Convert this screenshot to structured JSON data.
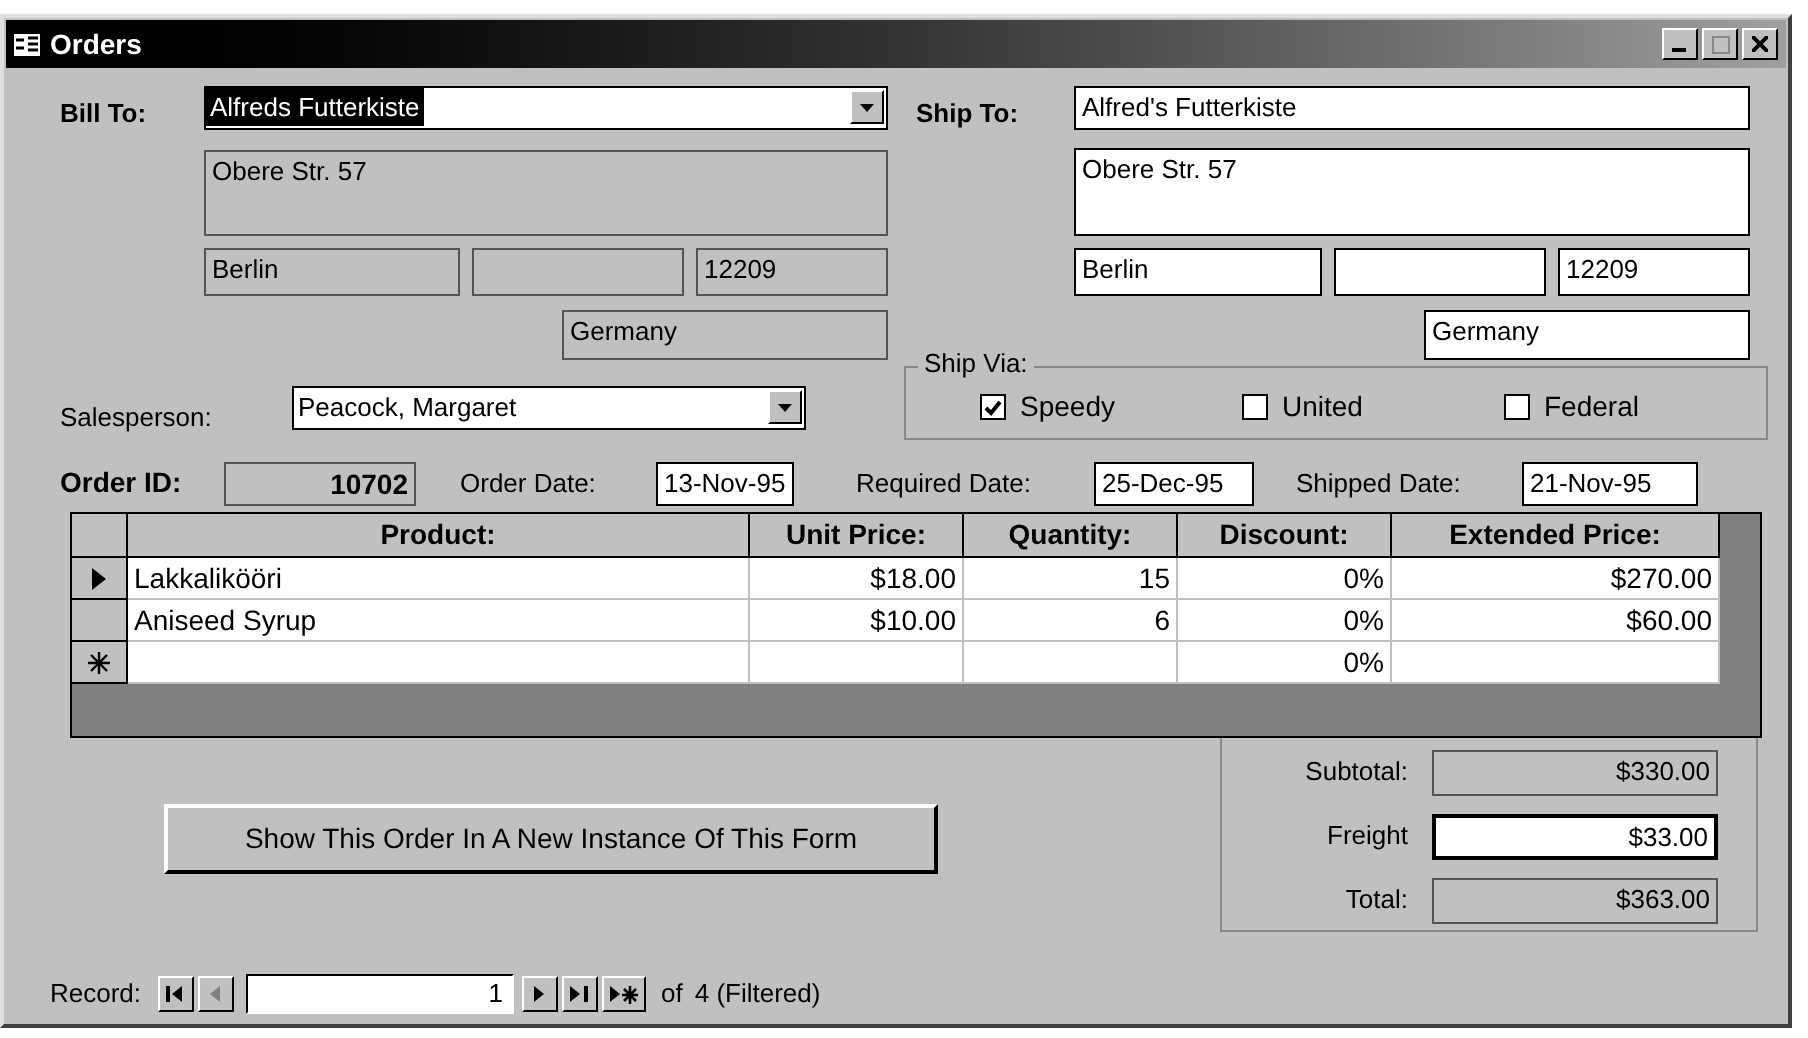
{
  "window": {
    "title": "Orders"
  },
  "bill_to": {
    "label": "Bill To:",
    "name": "Alfreds Futterkiste",
    "name_selected": true,
    "address": "Obere Str. 57",
    "city": "Berlin",
    "postal_code": "12209",
    "country": "Germany"
  },
  "ship_to": {
    "label": "Ship To:",
    "name": "Alfred's Futterkiste",
    "address": "Obere Str. 57",
    "city": "Berlin",
    "postal_code": "12209",
    "country": "Germany"
  },
  "salesperson": {
    "label": "Salesperson:",
    "value": "Peacock, Margaret"
  },
  "ship_via": {
    "label": "Ship Via:",
    "options": [
      {
        "label": "Speedy",
        "checked": true
      },
      {
        "label": "United",
        "checked": false
      },
      {
        "label": "Federal",
        "checked": false
      }
    ]
  },
  "order_id": {
    "label": "Order ID:",
    "value": "10702"
  },
  "dates": [
    {
      "label": "Order Date:",
      "value": "13-Nov-95"
    },
    {
      "label": "Required Date:",
      "value": "25-Dec-95"
    },
    {
      "label": "Shipped Date:",
      "value": "21-Nov-95"
    }
  ],
  "details": {
    "columns": [
      "Product:",
      "Unit Price:",
      "Quantity:",
      "Discount:",
      "Extended Price:"
    ],
    "rows": [
      {
        "selected": true,
        "cells": [
          "Lakkalikööri",
          "$18.00",
          "15",
          "0%",
          "$270.00"
        ]
      },
      {
        "selected": false,
        "cells": [
          "Aniseed Syrup",
          "$10.00",
          "6",
          "0%",
          "$60.00"
        ]
      }
    ],
    "new_row": {
      "discount": "0%"
    }
  },
  "action_button": "Show This Order In A New Instance Of This Form",
  "totals": [
    {
      "label": "Subtotal:",
      "value": "$330.00",
      "editable": false
    },
    {
      "label": "Freight",
      "value": "$33.00",
      "editable": true
    },
    {
      "label": "Total:",
      "value": "$363.00",
      "editable": false
    }
  ],
  "navigation": {
    "label": "Record:",
    "value": "1",
    "of": "of",
    "count": "4 (Filtered)",
    "buttons": [
      {
        "kind": "first",
        "disabled": false
      },
      {
        "kind": "previous",
        "disabled": true
      },
      {
        "kind": "next",
        "disabled": false
      },
      {
        "kind": "last",
        "disabled": false
      },
      {
        "kind": "new",
        "disabled": false
      }
    ]
  }
}
